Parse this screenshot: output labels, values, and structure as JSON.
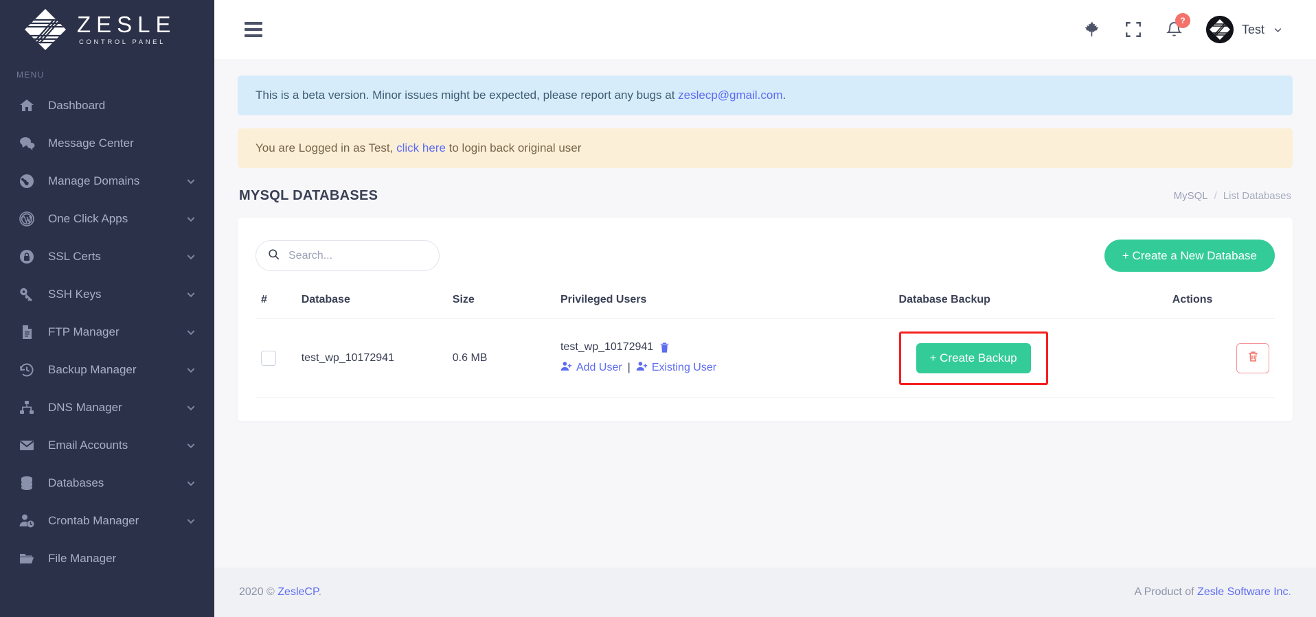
{
  "brand": {
    "name": "ZESLE",
    "subtitle": "CONTROL PANEL",
    "logo_icon": "zesle-diamond-logo"
  },
  "sidebar": {
    "section_label": "MENU",
    "items": [
      {
        "label": "Dashboard",
        "icon": "home-icon",
        "chevron": false
      },
      {
        "label": "Message Center",
        "icon": "chat-bubbles-icon",
        "chevron": false
      },
      {
        "label": "Manage Domains",
        "icon": "globe-icon",
        "chevron": true
      },
      {
        "label": "One Click Apps",
        "icon": "wordpress-icon",
        "chevron": true
      },
      {
        "label": "SSL Certs",
        "icon": "lock-shield-icon",
        "chevron": true
      },
      {
        "label": "SSH Keys",
        "icon": "key-icon",
        "chevron": true
      },
      {
        "label": "FTP Manager",
        "icon": "document-icon",
        "chevron": true
      },
      {
        "label": "Backup Manager",
        "icon": "history-clock-icon",
        "chevron": true
      },
      {
        "label": "DNS Manager",
        "icon": "sitemap-icon",
        "chevron": true
      },
      {
        "label": "Email Accounts",
        "icon": "envelope-icon",
        "chevron": true
      },
      {
        "label": "Databases",
        "icon": "database-icon",
        "chevron": true
      },
      {
        "label": "Crontab Manager",
        "icon": "user-clock-icon",
        "chevron": true
      },
      {
        "label": "File Manager",
        "icon": "folder-open-icon",
        "chevron": false
      }
    ]
  },
  "topbar": {
    "hamburger_icon": "hamburger-menu-icon",
    "leaf_icon": "maple-leaf-icon",
    "fullscreen_icon": "fullscreen-expand-icon",
    "bell_icon": "bell-notification-icon",
    "bell_badge": "?",
    "avatar_icon": "user-avatar-logo",
    "user_name": "Test",
    "caret_icon": "chevron-down-icon"
  },
  "alerts": {
    "beta": {
      "text_before": "This is a beta version. Minor issues might be expected, please report any bugs at ",
      "link": "zeslecp@gmail.com",
      "text_after": "."
    },
    "impersonation": {
      "text_before": "You are Logged in as Test, ",
      "link": "click here",
      "text_after": " to login back original user"
    }
  },
  "page": {
    "title": "MYSQL DATABASES",
    "breadcrumb": {
      "root": "MySQL",
      "separator": "/",
      "current": "List Databases"
    }
  },
  "toolbar": {
    "search_placeholder": "Search...",
    "search_value": "",
    "search_icon": "search-icon",
    "create_db_label": "+  Create a New Database"
  },
  "table": {
    "headers": [
      "#",
      "Database",
      "Size",
      "Privileged Users",
      "Database Backup",
      "Actions"
    ],
    "rows": [
      {
        "checked": false,
        "database": "test_wp_10172941",
        "size": "0.6 MB",
        "privileged_user": "test_wp_10172941",
        "delete_user_icon": "trash-icon",
        "add_user_label": "Add User",
        "add_user_icon": "user-plus-icon",
        "separator": "|",
        "existing_user_label": "Existing User",
        "existing_user_icon": "user-plus-icon",
        "backup_label": "+  Create Backup",
        "delete_icon": "trash-icon"
      }
    ]
  },
  "footer": {
    "left_prefix": "2020 © ",
    "left_link": "ZesleCP",
    "left_suffix": ".",
    "right_prefix": "A Product of ",
    "right_link": "Zesle Software Inc",
    "right_suffix": "."
  },
  "colors": {
    "sidebar_bg": "#2b3148",
    "accent_green": "#33cc99",
    "link_blue": "#5d6cf0",
    "highlight_red": "#f52020",
    "danger": "#f4726b",
    "info_bg": "#d7ecfb",
    "warn_bg": "#fcefd7"
  }
}
